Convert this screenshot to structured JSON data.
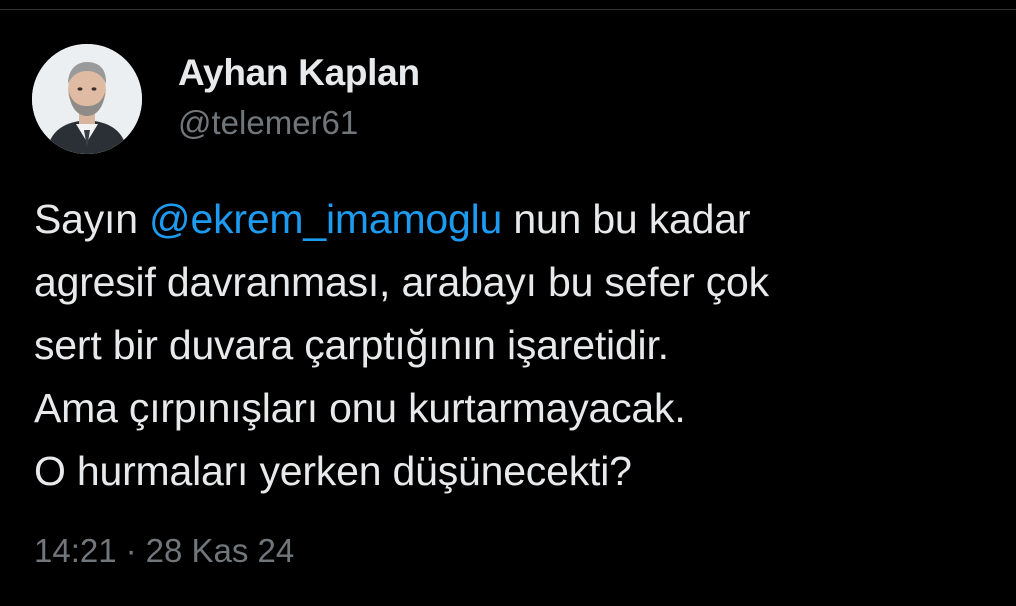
{
  "author": {
    "display_name": "Ayhan Kaplan",
    "handle": "@telemer61"
  },
  "tweet": {
    "line1_prefix": "Sayın ",
    "line1_mention": "@ekrem_imamoglu",
    "line1_suffix": " nun bu kadar",
    "line2": "agresif davranması, arabayı bu sefer çok",
    "line3": "sert bir duvara çarptığının işaretidir.",
    "line4": "Ama çırpınışları onu kurtarmayacak.",
    "line5": "O hurmaları yerken düşünecekti?"
  },
  "meta": {
    "time": "14:21",
    "separator": "·",
    "date": "28 Kas 24"
  },
  "colors": {
    "background": "#000000",
    "text": "#e7e9ea",
    "secondary": "#71767b",
    "mention": "#1d9bf0"
  }
}
